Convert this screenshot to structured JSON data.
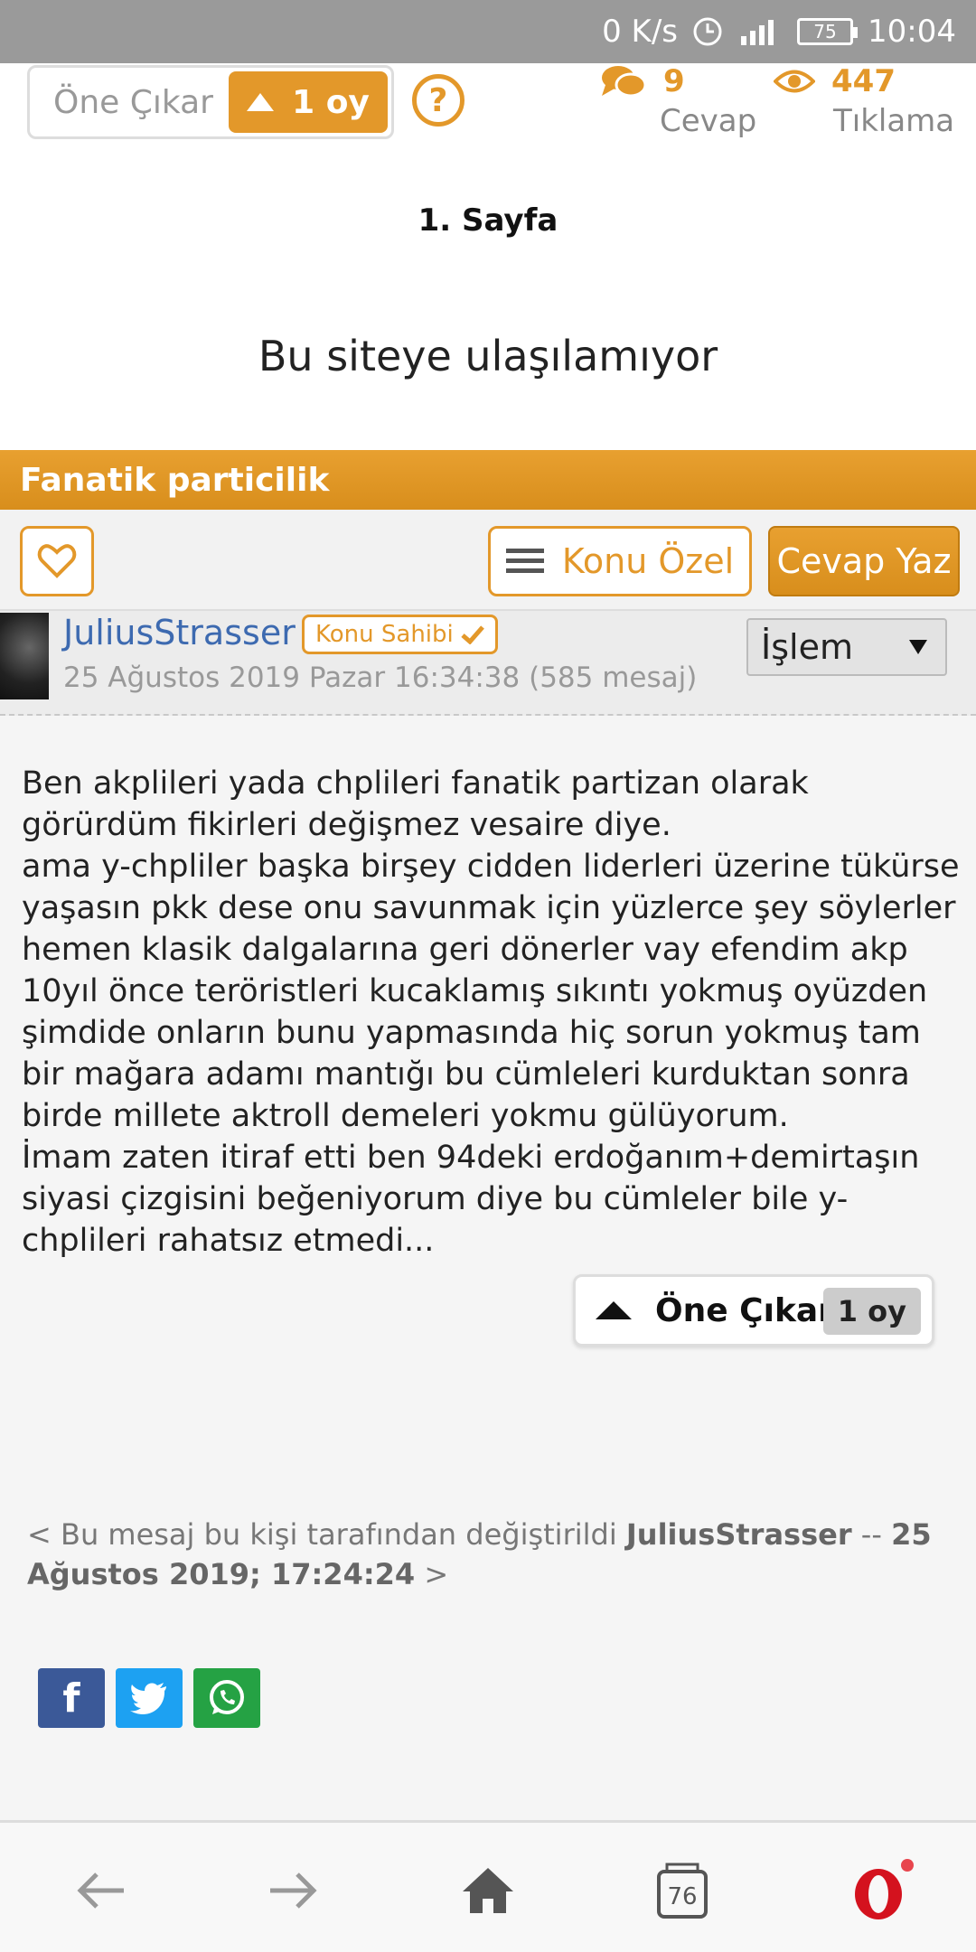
{
  "statusbar": {
    "speed": "0 K/s",
    "battery": "75",
    "time": "10:04"
  },
  "topbar": {
    "onecikar_label": "Öne Çıkar",
    "vote_label": "1 oy",
    "help_label": "?",
    "replies_count": "9",
    "replies_label": "Cevap",
    "views_count": "447",
    "views_label": "Tıklama"
  },
  "page": {
    "page_number": "1. Sayfa",
    "error_message": "Bu siteye ulaşılamıyor"
  },
  "thread": {
    "title": "Fanatik particilik"
  },
  "actions": {
    "konu_ozel": "Konu Özel",
    "cevap_yaz": "Cevap Yaz"
  },
  "post": {
    "username": "JuliusStrasser",
    "owner_badge": "Konu Sahibi",
    "date": "25 Ağustos 2019 Pazar 16:34:38 (585 mesaj)",
    "islem_label": "İşlem",
    "body_lines": [
      "Ben akplileri yada chplileri fanatik partizan olarak",
      "görürdüm fikirleri değişmez vesaire diye.",
      "ama y-chpliler başka birşey cidden liderleri üzerine tükürse",
      "yaşasın pkk dese onu savunmak için yüzlerce şey söylerler",
      "hemen klasik dalgalarına geri dönerler vay efendim akp",
      "10yıl önce teröristleri kucaklamış sıkıntı yokmuş oyüzden",
      "şimdide onların bunu yapmasında hiç sorun yokmuş tam",
      "bir mağara adamı mantığı bu cümleleri kurduktan sonra",
      "birde millete aktroll demeleri yokmu gülüyorum.",
      "İmam zaten itiraf etti ben 94deki erdoğanım+demirtaşın",
      "siyasi çizgisini beğeniyorum diye bu cümleler bile y-",
      "chplileri rahatsız etmedi..."
    ],
    "vote_label": "Öne Çıkar",
    "vote_count": "1 oy",
    "edit_prefix": "< Bu mesaj bu kişi tarafından değiştirildi ",
    "edit_user": "JuliusStrasser",
    "edit_sep": " -- ",
    "edit_date": "25 Ağustos 2019; 17:24:24",
    "edit_suffix": " >"
  },
  "share": {
    "facebook": "f",
    "twitter": "twitter-icon",
    "whatsapp": "whatsapp-icon"
  },
  "navbar": {
    "tabs_count": "76"
  },
  "colors": {
    "accent": "#e3982a",
    "link": "#3d6ab0",
    "opera_red": "#d4121e"
  }
}
